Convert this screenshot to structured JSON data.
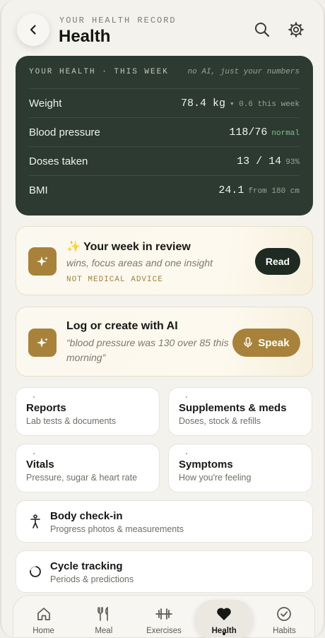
{
  "header": {
    "eyebrow": "YOUR HEALTH RECORD",
    "title": "Health"
  },
  "stats": {
    "heading": "YOUR HEALTH · THIS WEEK",
    "note": "no AI, just your numbers",
    "rows": [
      {
        "label": "Weight",
        "value": "78.4 kg",
        "sub": "▾ 0.6 this week"
      },
      {
        "label": "Blood pressure",
        "value": "118/76",
        "sub": "normal"
      },
      {
        "label": "Doses taken",
        "value": "13 / 14",
        "sub": "93%"
      },
      {
        "label": "BMI",
        "value": "24.1",
        "sub": "from 180 cm"
      }
    ]
  },
  "review_card": {
    "icon": "sparkle-icon",
    "title": "✨ Your week in review",
    "subtitle": "wins, focus areas and one insight",
    "tag": "NOT MEDICAL ADVICE",
    "button": "Read"
  },
  "log_card": {
    "icon": "sparkle-icon",
    "title": "Log or create with AI",
    "subtitle": "“blood pressure was 130 over 85 this morning”",
    "button": "Speak"
  },
  "tiles": [
    {
      "title": "Reports",
      "subtitle": "Lab tests & documents"
    },
    {
      "title": "Supplements & meds",
      "subtitle": "Doses, stock & refills"
    },
    {
      "title": "Vitals",
      "subtitle": "Pressure, sugar & heart rate"
    },
    {
      "title": "Symptoms",
      "subtitle": "How you're feeling"
    }
  ],
  "rows": [
    {
      "icon": "person-icon",
      "title": "Body check-in",
      "subtitle": "Progress photos & measurements"
    },
    {
      "icon": "cycle-icon",
      "title": "Cycle tracking",
      "subtitle": "Periods & predictions"
    }
  ],
  "nav": [
    {
      "icon": "home-icon",
      "label": "Home"
    },
    {
      "icon": "fork-knife-icon",
      "label": "Meal"
    },
    {
      "icon": "dumbbell-icon",
      "label": "Exercises"
    },
    {
      "icon": "heart-icon",
      "label": "Health",
      "active": true
    },
    {
      "icon": "check-circle-icon",
      "label": "Habits"
    }
  ],
  "colors": {
    "dark_card": "#2c3a31",
    "accent_gold": "#a8823a",
    "normal_green": "#7fbf8e"
  }
}
